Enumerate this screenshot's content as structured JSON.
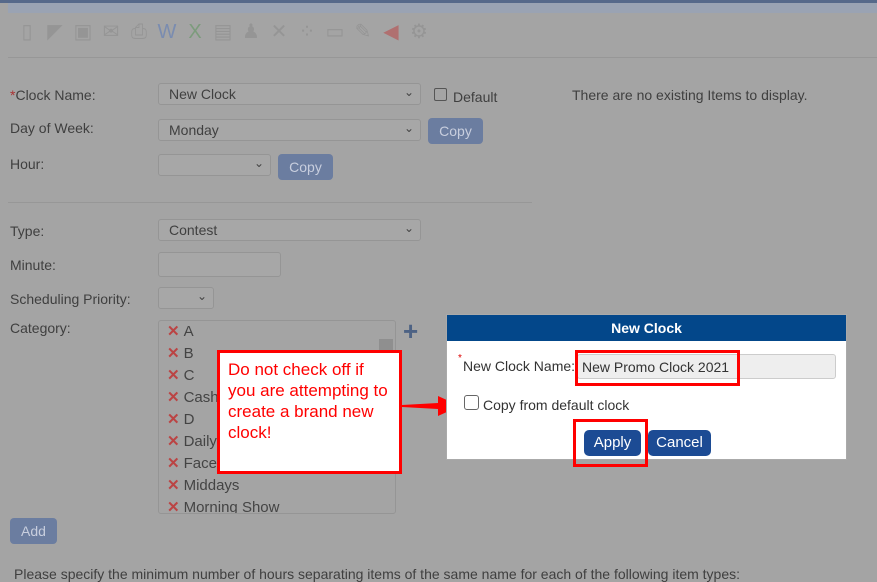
{
  "toolbar": {
    "icons": [
      "new-doc-icon",
      "edit-icon",
      "save-icon",
      "email-icon",
      "print-icon",
      "word-export-icon",
      "excel-export-icon",
      "pdf-export-icon",
      "user-icon",
      "delete-icon",
      "footprints-icon",
      "link-icon",
      "notes-icon",
      "undo-icon",
      "settings-gear-icon"
    ]
  },
  "form": {
    "clock_name_label": "Clock Name:",
    "clock_name_value": "New Clock",
    "default_label": "Default",
    "day_label": "Day of Week:",
    "day_value": "Monday",
    "copy_label": "Copy",
    "hour_label": "Hour:",
    "hour_value": "",
    "copy2_label": "Copy",
    "type_label": "Type:",
    "type_value": "Contest",
    "minute_label": "Minute:",
    "minute_value": "",
    "priority_label": "Scheduling Priority:",
    "priority_value": "",
    "category_label": "Category:",
    "categories": [
      "A",
      "B",
      "C",
      "Cash",
      "D",
      "Daily",
      "Face",
      "Middays",
      "Morning Show"
    ],
    "add_label": "Add",
    "footer_text": "Please specify the minimum number of hours separating items of the same name for each of the following item types:"
  },
  "empty_message": "There are no existing Items to display.",
  "dialog": {
    "title": "New Clock",
    "name_label": "New Clock Name:",
    "name_value": "New Promo Clock 2021",
    "copy_label": "Copy from default clock",
    "apply": "Apply",
    "cancel": "Cancel"
  },
  "callout": {
    "text": "Do not check off if you are attempting to create a brand new clock!"
  },
  "colors": {
    "dialog_header": "#03478a",
    "annotation": "#ff0000",
    "button": "#1c4b94"
  }
}
